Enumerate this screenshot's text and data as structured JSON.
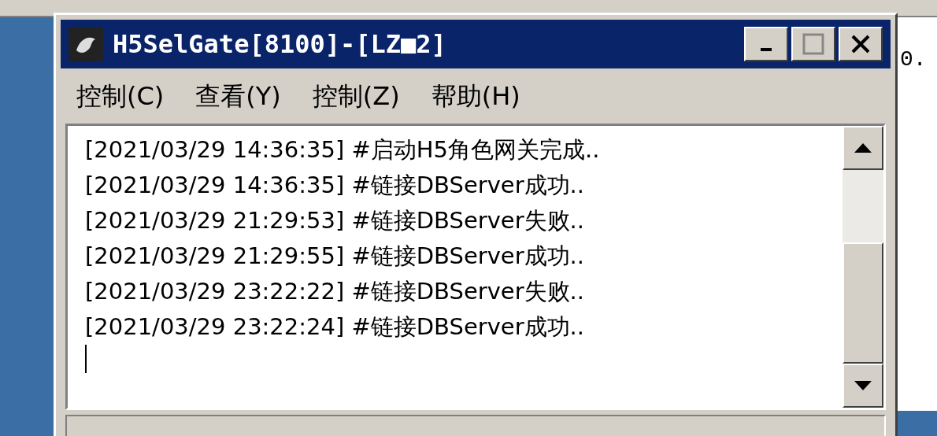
{
  "background_window": {
    "cell_text": "0."
  },
  "window": {
    "title": "H5SelGate[8100]-[LZ■2]"
  },
  "menu": [
    {
      "label": "控制(C)"
    },
    {
      "label": "查看(Y)"
    },
    {
      "label": "控制(Z)"
    },
    {
      "label": "帮助(H)"
    }
  ],
  "log": [
    "[2021/03/29 14:36:35] #启动H5角色网关完成..",
    "[2021/03/29 14:36:35] #链接DBServer成功..",
    "[2021/03/29 21:29:53] #链接DBServer失败..",
    "[2021/03/29 21:29:55] #链接DBServer成功..",
    "[2021/03/29 23:22:22] #链接DBServer失败..",
    "[2021/03/29 23:22:24] #链接DBServer成功.."
  ]
}
